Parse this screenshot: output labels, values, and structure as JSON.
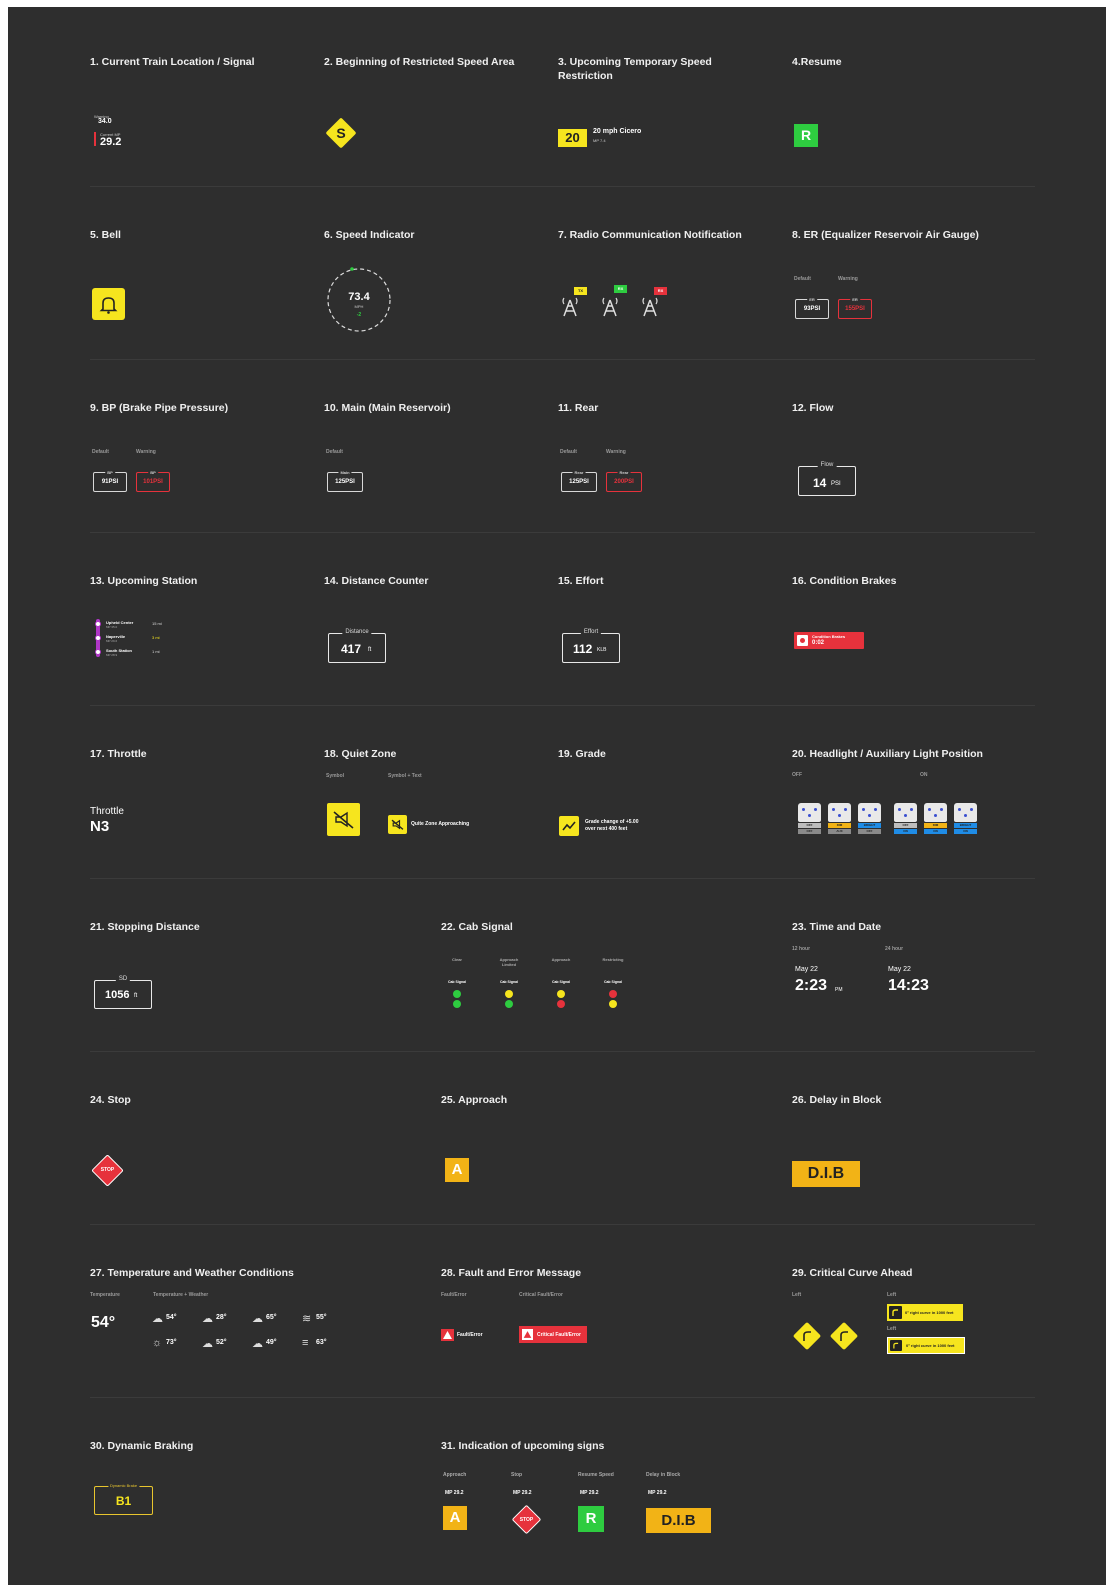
{
  "items": {
    "i1": {
      "title": "1. Current Train Location / Signal",
      "small1": "Warning",
      "val1": "34.0",
      "small2": "Current MP",
      "val2": "29.2"
    },
    "i2": {
      "title": "2. Beginning of Restricted Speed Area",
      "letter": "S"
    },
    "i3": {
      "title": "3. Upcoming Temporary Speed Restriction",
      "speed": "20",
      "text": "20 mph Cicero",
      "sub": "MP 7.4"
    },
    "i4": {
      "title": "4.Resume",
      "letter": "R"
    },
    "i5": {
      "title": "5. Bell"
    },
    "i6": {
      "title": "6. Speed Indicator",
      "speed": "73.4",
      "unit": "MPH",
      "delta": "-2"
    },
    "i7": {
      "title": "7. Radio Communication Notification",
      "tags": [
        "TX",
        "RX",
        "RX"
      ]
    },
    "i8": {
      "title": "8. ER (Equalizer Reservoir Air Gauge)",
      "labels": [
        "Default",
        "Warning"
      ],
      "gauge_label": "ER",
      "values": [
        "93PSI",
        "155PSI"
      ]
    },
    "i9": {
      "title": "9. BP (Brake Pipe Pressure)",
      "labels": [
        "Default",
        "Warning"
      ],
      "gauge_label": "BP",
      "values": [
        "91PSI",
        "101PSI"
      ]
    },
    "i10": {
      "title": "10. Main (Main Reservoir)",
      "labels": [
        "Default"
      ],
      "gauge_label": "Main",
      "values": [
        "125PSI"
      ]
    },
    "i11": {
      "title": "11. Rear",
      "labels": [
        "Default",
        "Warning"
      ],
      "gauge_label": "Rear",
      "values": [
        "125PSI",
        "200PSI"
      ]
    },
    "i12": {
      "title": "12. Flow",
      "label": "Flow",
      "value": "14",
      "unit": "PSI"
    },
    "i13": {
      "title": "13. Upcoming Station",
      "stations": [
        {
          "name": "Upheld Center",
          "sub": "MP 35.0",
          "dist": "15 mi"
        },
        {
          "name": "Naperville",
          "sub": "MP 29.6",
          "dist": "3 mi"
        },
        {
          "name": "South Station",
          "sub": "MP 28.9",
          "dist": "1 mi"
        }
      ]
    },
    "i14": {
      "title": "14. Distance Counter",
      "label": "Distance",
      "value": "417",
      "unit": "ft"
    },
    "i15": {
      "title": "15. Effort",
      "label": "Effort",
      "value": "112",
      "unit": "KLB"
    },
    "i16": {
      "title": "16. Condition Brakes",
      "text": "Condition Brakes",
      "time": "0:02"
    },
    "i17": {
      "title": "17. Throttle",
      "label": "Throttle",
      "value": "N3"
    },
    "i18": {
      "title": "18. Quiet Zone",
      "labels": [
        "Symbol",
        "Symbol + Text"
      ],
      "text": "Quite Zone Approaching"
    },
    "i19": {
      "title": "19. Grade",
      "text1": "Grade change of +5.00",
      "text2": "over next 400 feet"
    },
    "i20": {
      "title": "20. Headlight / Auxiliary Light Position",
      "labels": [
        "OFF",
        "ON"
      ],
      "lamps": [
        {
          "b1": "OFF",
          "b2": "OFF",
          "c1": "#bdbdbd",
          "c2": "#8a8a8a"
        },
        {
          "b1": "DIM",
          "b2": "AUX",
          "c1": "#f2b316",
          "c2": "#8a8a8a"
        },
        {
          "b1": "BRIGHT",
          "b2": "OFF",
          "c1": "#1f8ce6",
          "c2": "#8a8a8a"
        },
        {
          "b1": "OFF",
          "b2": "ON",
          "c1": "#bdbdbd",
          "c2": "#1f8ce6"
        },
        {
          "b1": "DIM",
          "b2": "ON",
          "c1": "#f2b316",
          "c2": "#1f8ce6"
        },
        {
          "b1": "BRIGHT",
          "b2": "ON",
          "c1": "#1f8ce6",
          "c2": "#1f8ce6"
        }
      ]
    },
    "i21": {
      "title": "21. Stopping Distance",
      "label": "SD",
      "value": "1056",
      "unit": "ft"
    },
    "i22": {
      "title": "22. Cab Signal",
      "signals": [
        {
          "name": "Clear",
          "top": "#2ecc40",
          "bottom": "#2ecc40"
        },
        {
          "name": "Approach Limited",
          "top": "#f6e51e",
          "bottom": "#2ecc40"
        },
        {
          "name": "Approach",
          "top": "#f6e51e",
          "bottom": "#e6323c"
        },
        {
          "name": "Restricting",
          "top": "#e6323c",
          "bottom": "#f6e51e"
        }
      ],
      "cab_label": "Cab Signal"
    },
    "i23": {
      "title": "23. Time and Date",
      "labels": [
        "12 hour",
        "24 hour"
      ],
      "date": "May 22",
      "t12": "2:23",
      "ampm": "PM",
      "t24": "14:23"
    },
    "i24": {
      "title": "24. Stop",
      "text": "STOP"
    },
    "i25": {
      "title": "25. Approach",
      "letter": "A"
    },
    "i26": {
      "title": "26. Delay in Block",
      "text": "D.I.B"
    },
    "i27": {
      "title": "27. Temperature and Weather Conditions",
      "labels": [
        "Temperature",
        "Temperature + Weather"
      ],
      "temp": "54°",
      "weather": [
        {
          "icon": "cloud-icon",
          "glyph": "☁",
          "t": "54°"
        },
        {
          "icon": "snow-cloud-icon",
          "glyph": "☁",
          "t": "28°"
        },
        {
          "icon": "rain-cloud-icon",
          "glyph": "☁",
          "t": "65°"
        },
        {
          "icon": "wind-icon",
          "glyph": "≋",
          "t": "55°"
        },
        {
          "icon": "sun-icon",
          "glyph": "☼",
          "t": "73°"
        },
        {
          "icon": "storm-icon",
          "glyph": "☁",
          "t": "52°"
        },
        {
          "icon": "cloud-icon",
          "glyph": "☁",
          "t": "49°"
        },
        {
          "icon": "fog-icon",
          "glyph": "≡",
          "t": "63°"
        }
      ]
    },
    "i28": {
      "title": "28. Fault and Error Message",
      "labels": [
        "Fault/Error",
        "Critical Fault/Error"
      ],
      "text1": "Fault/Error",
      "text2": "Critical Fault/Error"
    },
    "i29": {
      "title": "29. Critical Curve Ahead",
      "labels": [
        "Left",
        "Left",
        "Left"
      ],
      "text1": "0° right curve in 1000 feet",
      "text2": "0° right curve in 1000 feet"
    },
    "i30": {
      "title": "30. Dynamic Braking",
      "label": "Dynamic Brake",
      "value": "B1"
    },
    "i31": {
      "title": "31. Indication of upcoming signs",
      "labels": [
        "Approach",
        "Stop",
        "Resume Speed",
        "Delay in Block"
      ],
      "mp": "MP 29.2",
      "signs": [
        "A",
        "STOP",
        "R",
        "D.I.B"
      ]
    }
  },
  "colors": {
    "bg": "#2e2e2e",
    "yellow": "#f6e51e",
    "amber": "#f2b316",
    "green": "#2ecc40",
    "red": "#e6323c",
    "blue": "#1f8ce6",
    "magenta": "#b036c7"
  }
}
